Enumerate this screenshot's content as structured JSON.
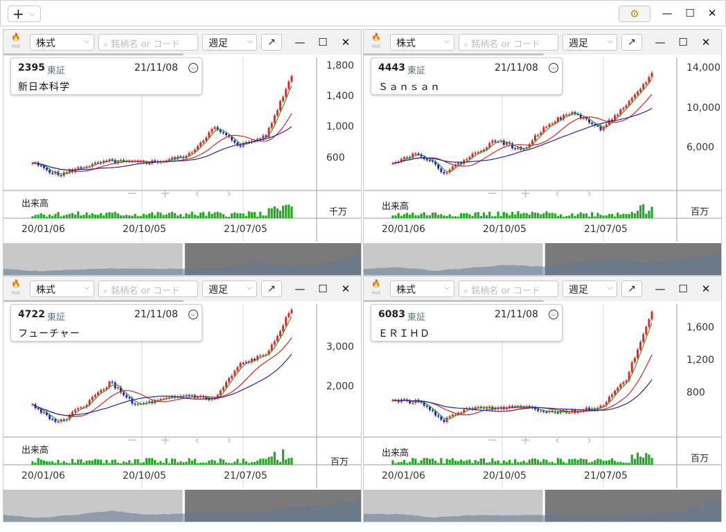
{
  "toolbar": {
    "add_symbol": "+",
    "dropdown": "⌵",
    "settings_icon": "gear-icon"
  },
  "window_controls": {
    "minimize": "—",
    "maximize": "☐",
    "close": "✕"
  },
  "common": {
    "market_type": "株式",
    "search_placeholder": "銘柄名 or コード",
    "period": "週足",
    "popout": "↗",
    "hot": "Hot",
    "volume_label": "出来高",
    "x_labels": [
      "20/01/06",
      "20/10/05",
      "21/07/05"
    ],
    "zoom_out": "−",
    "zoom_in": "+",
    "prev": "‹",
    "next": "›"
  },
  "panels": [
    {
      "code": "2395",
      "exchange": "東証",
      "date": "21/11/08",
      "name": "新日本科学",
      "y_labels": [
        "1,800",
        "1,400",
        "1,000",
        "600"
      ],
      "volume_unit": "千万"
    },
    {
      "code": "4443",
      "exchange": "東証",
      "date": "21/11/08",
      "name": "Ｓａｎｓａｎ",
      "y_labels": [
        "14,000",
        "10,000",
        "6,000"
      ],
      "volume_unit": "百万"
    },
    {
      "code": "4722",
      "exchange": "東証",
      "date": "21/11/08",
      "name": "フューチャー",
      "y_labels": [
        "3,000",
        "2,000"
      ],
      "volume_unit": "百万"
    },
    {
      "code": "6083",
      "exchange": "東証",
      "date": "21/11/08",
      "name": "ＥＲＩＨＤ",
      "y_labels": [
        "1,600",
        "1,200",
        "800"
      ],
      "volume_unit": "百万"
    }
  ],
  "chart_data": [
    {
      "type": "line",
      "title": "2395 新日本科学",
      "ylim": [
        400,
        1900
      ],
      "x": [
        "20/01/06",
        "20/10/05",
        "21/07/05",
        "21/11/08"
      ],
      "series": [
        {
          "name": "",
          "values": [
            700,
            560,
            660,
            720,
            700,
            720,
            780,
            1100,
            900,
            1000,
            1700
          ]
        }
      ]
    },
    {
      "type": "line",
      "title": "4443 Ｓａｎｓａｎ",
      "ylim": [
        3000,
        15000
      ],
      "x": [
        "20/01/06",
        "20/10/05",
        "21/07/05",
        "21/11/08"
      ],
      "series": [
        {
          "name": "",
          "values": [
            5500,
            6300,
            4500,
            6000,
            7500,
            6500,
            9000,
            10000,
            8500,
            10500,
            13500
          ]
        }
      ]
    },
    {
      "type": "line",
      "title": "4722 フューチャー",
      "ylim": [
        1200,
        3800
      ],
      "x": [
        "20/01/06",
        "20/10/05",
        "21/07/05",
        "21/11/08"
      ],
      "series": [
        {
          "name": "",
          "values": [
            1800,
            1450,
            1800,
            2250,
            1800,
            1900,
            2000,
            1900,
            2600,
            2800,
            3700
          ]
        }
      ]
    },
    {
      "type": "line",
      "title": "6083 ＥＲＩＨＤ",
      "ylim": [
        400,
        1800
      ],
      "x": [
        "20/01/06",
        "20/10/05",
        "21/07/05",
        "21/11/08"
      ],
      "series": [
        {
          "name": "",
          "values": [
            780,
            760,
            560,
            700,
            690,
            720,
            660,
            660,
            700,
            1000,
            1700
          ]
        }
      ]
    }
  ]
}
